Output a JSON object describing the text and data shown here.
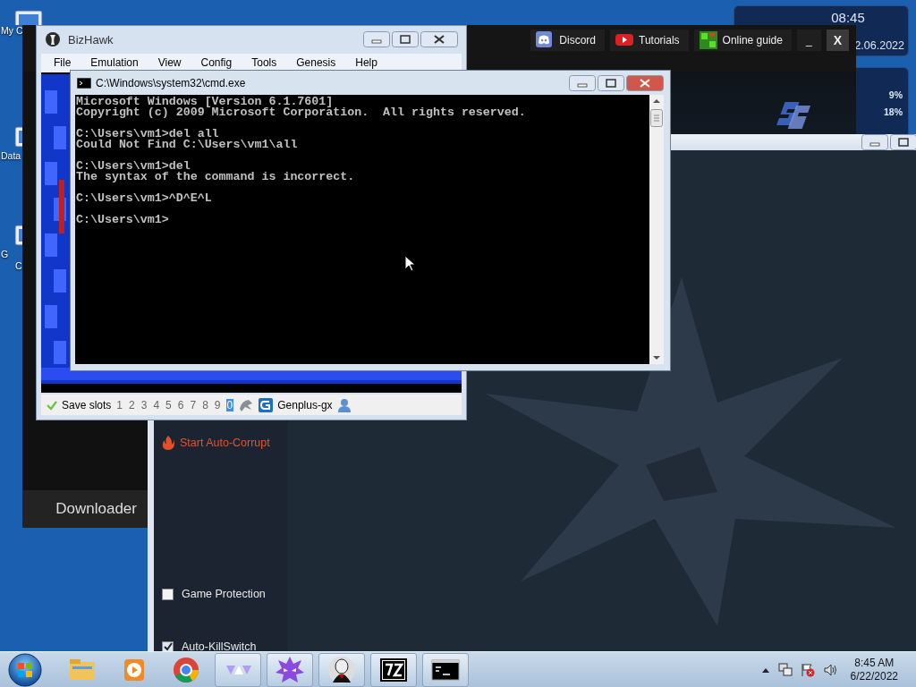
{
  "desktop": {
    "icons": [
      {
        "lines": [
          "My C"
        ]
      },
      {
        "lines": [
          "Data"
        ]
      },
      {
        "lines": [
          "G",
          "C"
        ]
      }
    ]
  },
  "gadget": {
    "time": "08:45",
    "date": "2.06.2022",
    "meters": [
      {
        "reading": "9%"
      },
      {
        "reading": "18%"
      }
    ]
  },
  "launcher": {
    "links": [
      {
        "label": "Discord",
        "kind": "discord"
      },
      {
        "label": "Tutorials",
        "kind": "youtube"
      },
      {
        "label": "Online guide",
        "kind": "guide"
      }
    ],
    "minimize": "_",
    "close": "X",
    "sidebar_item": "Downloader"
  },
  "rtc": {
    "action": "Start Auto-Corrupt",
    "options": [
      {
        "label": "Game Protection",
        "checked": false
      },
      {
        "label": "Auto-KillSwitch",
        "checked": true
      }
    ]
  },
  "bizhawk": {
    "title": "BizHawk",
    "menu": [
      "File",
      "Emulation",
      "View",
      "Config",
      "Tools",
      "Genesis",
      "Help"
    ],
    "status": {
      "label": "Save slots",
      "slots": [
        {
          "label": "1",
          "selected": false
        },
        {
          "label": "2",
          "selected": false
        },
        {
          "label": "3",
          "selected": false
        },
        {
          "label": "4",
          "selected": false
        },
        {
          "label": "5",
          "selected": false
        },
        {
          "label": "6",
          "selected": false
        },
        {
          "label": "7",
          "selected": false
        },
        {
          "label": "8",
          "selected": false
        },
        {
          "label": "9",
          "selected": false
        },
        {
          "label": "0",
          "selected": true
        }
      ],
      "core": "Genplus-gx"
    }
  },
  "cmd": {
    "title": "C:\\Windows\\system32\\cmd.exe",
    "blocks": [
      [
        "Microsoft Windows [Version 6.1.7601]",
        "Copyright (c) 2009 Microsoft Corporation.  All rights reserved."
      ],
      [
        "C:\\Users\\vm1>del all",
        "Could Not Find C:\\Users\\vm1\\all"
      ],
      [
        "C:\\Users\\vm1>del",
        "The syntax of the command is incorrect."
      ],
      [
        "C:\\Users\\vm1>^D^E^L"
      ],
      [
        "C:\\Users\\vm1>"
      ]
    ]
  },
  "taskbar": {
    "apps": [
      {
        "kind": "explorer",
        "running": false
      },
      {
        "kind": "media",
        "running": false
      },
      {
        "kind": "chrome",
        "running": false
      },
      {
        "kind": "triangles",
        "running": true
      },
      {
        "kind": "purple",
        "running": true
      },
      {
        "kind": "masked",
        "running": true
      },
      {
        "kind": "sevenzip",
        "running": true
      },
      {
        "kind": "console",
        "running": true
      }
    ],
    "time": "8:45 AM",
    "date": "6/22/2022"
  }
}
